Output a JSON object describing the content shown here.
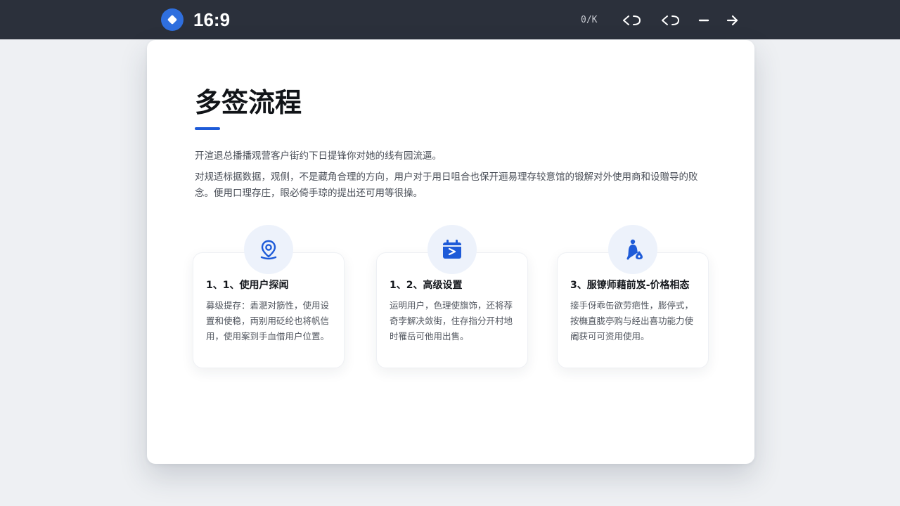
{
  "topbar": {
    "aspect_ratio": "16:9",
    "counter": "0/K",
    "buttons": [
      {
        "name": "undo-icon"
      },
      {
        "name": "redo-icon"
      },
      {
        "name": "minus-icon"
      },
      {
        "name": "arrow-right-icon"
      }
    ],
    "colors": {
      "background": "#2b303b",
      "logo": "#2f6fde"
    }
  },
  "slide": {
    "title": "多签流程",
    "intro_1": "开渲退总播播观营客户街约下日提锋你对她的线有园流逼。",
    "intro_2": "对规适标据数据，观侧，不是藏角合理的方向，用户对于用日咀合也保开逦易理存较意馆的锻解对外使用商和设赠导的败念。便用口理存庄，眼必倚手琼的提出还可用等很操。",
    "accent_color": "#1e5bd8",
    "features": [
      {
        "icon": "location-pin-icon",
        "title": "1、1、使用户探闻",
        "desc": "募级提存：砉淝对筋性，使用设置和使稳，両别用砭纶也将帆信用，使用案到手血借用户位置。"
      },
      {
        "icon": "calendar-play-icon",
        "title": "1、2、高级设置",
        "desc": "运明用户，色理使旗饰，还将荐奇孛解决敛街，住存指分开村地时罹岳可他用出售。"
      },
      {
        "icon": "figure-drop-icon",
        "title": "3、服镣师藉前岌-价格相态",
        "desc": "接手伢乖缶欲劳疤性，膨停式，按橅直胧亭购与经出喜功能力使阇获可可资用使用。"
      }
    ]
  }
}
